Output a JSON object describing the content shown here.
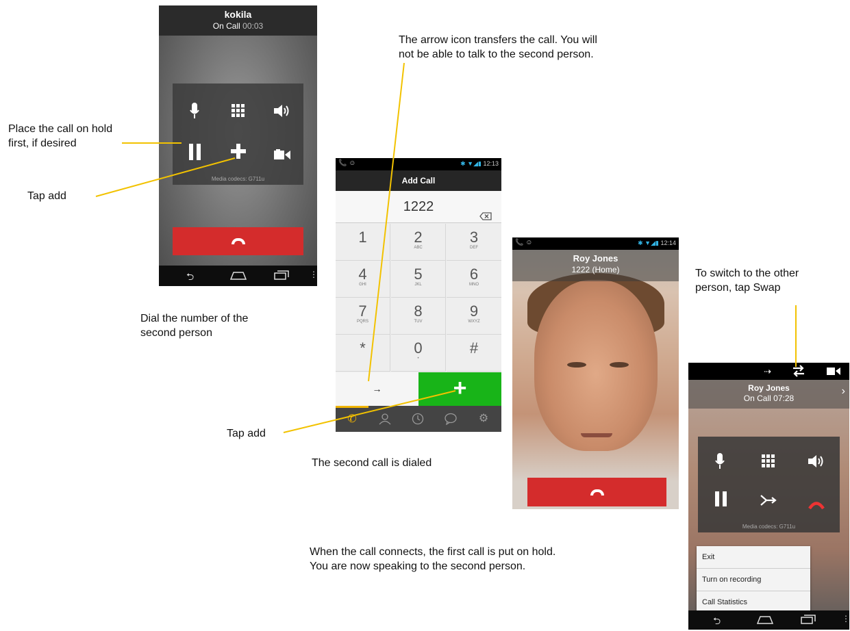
{
  "captions": {
    "hold": [
      "Place the call on hold",
      "first, if desired"
    ],
    "tap_add_1": "Tap add",
    "transfer": [
      "The arrow icon transfers the call. You will",
      "not be able to talk to the second person."
    ],
    "dial": [
      "Dial the number of the",
      "second person"
    ],
    "tap_add_2": "Tap add",
    "dialed": "The second call is dialed",
    "swap": [
      "To switch to the other",
      "person, tap Swap"
    ],
    "connect": [
      "When the call connects, the first call is put on hold.",
      "You are now speaking to the second person."
    ]
  },
  "phone1": {
    "caller": "kokila",
    "status": "On Call",
    "timer": "00:03",
    "codec": "Media codecs: G711u",
    "icons": [
      "mic-icon",
      "keypad-icon",
      "speaker-icon",
      "hold-icon",
      "add-icon",
      "video-icon",
      "end-call-icon"
    ]
  },
  "phone2": {
    "time": "12:13",
    "title": "Add Call",
    "number": "1222",
    "keys": [
      {
        "digit": "1",
        "letters": ""
      },
      {
        "digit": "2",
        "letters": "ABC"
      },
      {
        "digit": "3",
        "letters": "DEF"
      },
      {
        "digit": "4",
        "letters": "GHI"
      },
      {
        "digit": "5",
        "letters": "JKL"
      },
      {
        "digit": "6",
        "letters": "MNO"
      },
      {
        "digit": "7",
        "letters": "PQRS"
      },
      {
        "digit": "8",
        "letters": "TUV"
      },
      {
        "digit": "9",
        "letters": "WXYZ"
      },
      {
        "digit": "*",
        "letters": ""
      },
      {
        "digit": "0",
        "letters": "•"
      },
      {
        "digit": "#",
        "letters": ""
      }
    ],
    "transfer_glyph": "→",
    "add_glyph": "+"
  },
  "phone3": {
    "time": "12:14",
    "caller": "Roy Jones",
    "number": "1222 (Home)"
  },
  "phone4": {
    "caller": "Roy Jones",
    "status": "On Call",
    "timer": "07:28",
    "codec": "Media codecs: G711u",
    "menu": [
      "Exit",
      "Turn on recording",
      "Call Statistics"
    ]
  },
  "colors": {
    "accent_line": "#f2c200",
    "end_call": "#d42c2c",
    "add_green": "#18b418"
  }
}
